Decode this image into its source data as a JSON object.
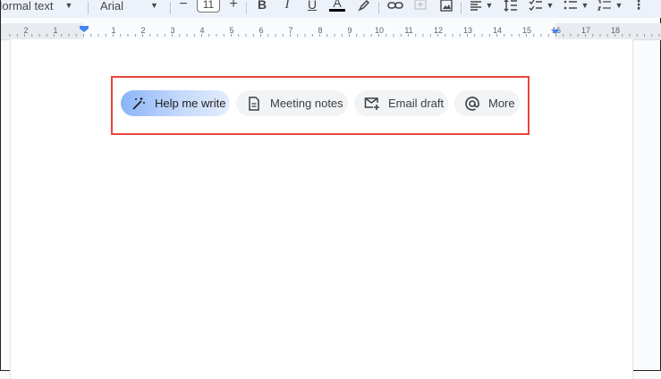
{
  "toolbar": {
    "style_label": "Normal text",
    "font_label": "Arial",
    "font_size": "11",
    "decrease_label": "−",
    "increase_label": "+",
    "bold_label": "B",
    "italic_label": "I",
    "underline_label": "U",
    "text_color_label": "A",
    "more_label": "⋮"
  },
  "ruler": {
    "labels": [
      "2",
      "1",
      "1",
      "2",
      "3",
      "4",
      "5",
      "6",
      "7",
      "8",
      "9",
      "10",
      "11",
      "12",
      "13",
      "14",
      "15",
      "16",
      "17",
      "18"
    ]
  },
  "chips": [
    {
      "label": "Help me write",
      "icon": "magic-pen-icon"
    },
    {
      "label": "Meeting notes",
      "icon": "document-icon"
    },
    {
      "label": "Email draft",
      "icon": "email-icon"
    },
    {
      "label": "More",
      "icon": "at-sign-icon"
    }
  ],
  "colors": {
    "highlight_border": "#e8453c",
    "primary_chip_start": "#8ab4f8",
    "chip_bg": "#f1f3f4"
  }
}
